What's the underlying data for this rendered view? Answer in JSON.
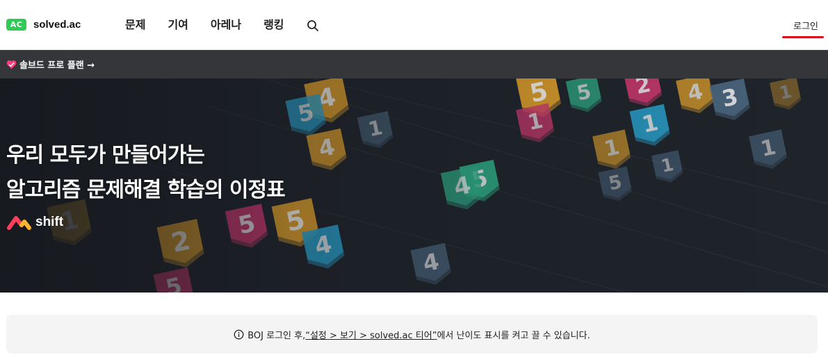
{
  "header": {
    "logo_badge": "AC",
    "logo_text": "solved.ac",
    "nav": [
      {
        "label": "문제",
        "name": "nav-problems"
      },
      {
        "label": "기여",
        "name": "nav-contribute"
      },
      {
        "label": "아레나",
        "name": "nav-arena"
      },
      {
        "label": "랭킹",
        "name": "nav-ranking"
      }
    ],
    "search_icon": "search-icon",
    "login_label": "로그인",
    "accent": "#d9101b",
    "logo_color": "#2ecc54"
  },
  "promo": {
    "icon": "heart-icon",
    "label": "솔브드 프로 플랜 →"
  },
  "hero": {
    "title_line1": "우리 모두가 만들어가는",
    "title_line2": "알고리즘 문제해결 학습의 이정표",
    "brand": "shift",
    "tier_badges": [
      "4",
      "5",
      "1",
      "4",
      "5",
      "5",
      "1",
      "5",
      "2",
      "1",
      "1",
      "4",
      "3",
      "1",
      "1",
      "5",
      "4",
      "5",
      "5",
      "1",
      "2",
      "4"
    ]
  },
  "notice": {
    "icon": "info-icon",
    "prefix": "BOJ 로그인 후, ",
    "link": "“설정 > 보기 > solved.ac 티어”",
    "suffix": "에서 난이도 표시를 켜고 끌 수 있습니다."
  }
}
